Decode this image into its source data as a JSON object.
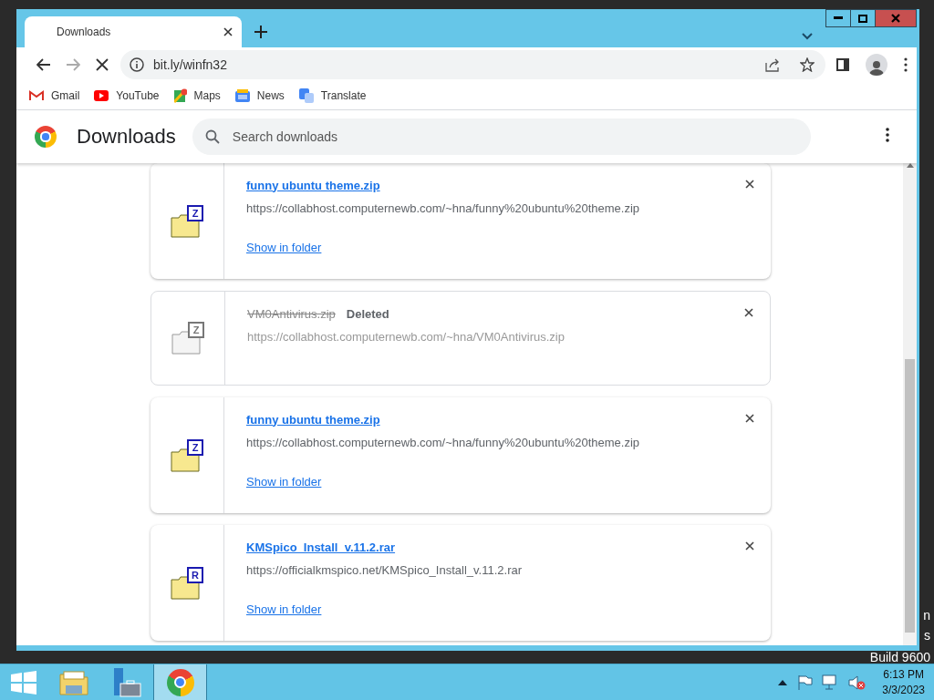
{
  "tabs": [
    {
      "title": "Downloads",
      "selected": true
    }
  ],
  "address_bar": {
    "url": "bit.ly/winfn32",
    "loading": true
  },
  "bookmarks": [
    {
      "label": "Gmail",
      "kind": "gmail"
    },
    {
      "label": "YouTube",
      "kind": "youtube"
    },
    {
      "label": "Maps",
      "kind": "maps"
    },
    {
      "label": "News",
      "kind": "news"
    },
    {
      "label": "Translate",
      "kind": "translate"
    }
  ],
  "page": {
    "title": "Downloads",
    "search": {
      "placeholder": "Search downloads"
    }
  },
  "downloads": [
    {
      "file_name": "funny ubuntu theme.zip",
      "url": "https://collabhost.computernewb.com/~hna/funny%20ubuntu%20theme.zip",
      "archive_letter": "Z",
      "deleted": false,
      "action": "Show in folder"
    },
    {
      "file_name": "VM0Antivirus.zip",
      "status": "Deleted",
      "url": "https://collabhost.computernewb.com/~hna/VM0Antivirus.zip",
      "archive_letter": "Z",
      "deleted": true
    },
    {
      "file_name": "funny ubuntu theme.zip",
      "url": "https://collabhost.computernewb.com/~hna/funny%20ubuntu%20theme.zip",
      "archive_letter": "Z",
      "deleted": false,
      "action": "Show in folder"
    },
    {
      "file_name": "KMSpico_Install_v.11.2.rar",
      "url": "https://officialkmspico.net/KMSpico_Install_v.11.2.rar",
      "archive_letter": "R",
      "deleted": false,
      "action": "Show in folder"
    }
  ],
  "desktop_text": [
    "n",
    "s",
    "Build 9600"
  ],
  "taskbar": {
    "items": [
      {
        "kind": "explorer",
        "selected": false
      },
      {
        "kind": "server-manager",
        "selected": false
      },
      {
        "kind": "chrome",
        "selected": true
      }
    ],
    "time": "6:13 PM",
    "date": "3/3/2023"
  }
}
